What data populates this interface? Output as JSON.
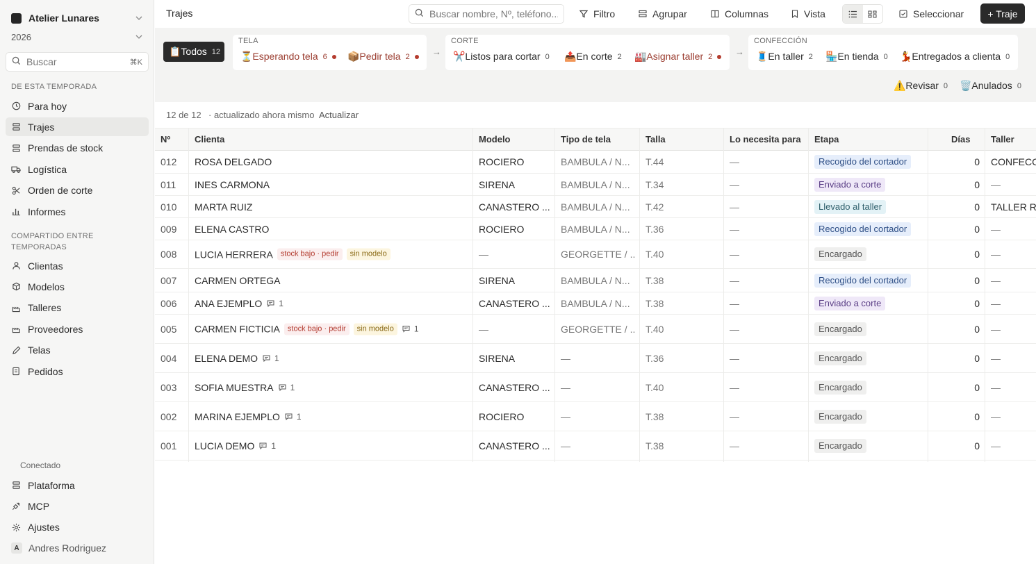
{
  "workspace": {
    "name": "Atelier Lunares",
    "year": "2026"
  },
  "sidebar": {
    "search_placeholder": "Buscar",
    "search_shortcut": "⌘K",
    "section1": "DE ESTA TEMPORADA",
    "items1": [
      {
        "label": "Para hoy",
        "icon": "clock-icon"
      },
      {
        "label": "Trajes",
        "icon": "layers-icon",
        "active": true
      },
      {
        "label": "Prendas de stock",
        "icon": "layers-icon"
      },
      {
        "label": "Logística",
        "icon": "truck-icon"
      },
      {
        "label": "Orden de corte",
        "icon": "scissors-icon"
      },
      {
        "label": "Informes",
        "icon": "chart-icon"
      }
    ],
    "section2_line1": "COMPARTIDO ENTRE",
    "section2_line2": "TEMPORADAS",
    "items2": [
      {
        "label": "Clientas",
        "icon": "user-icon"
      },
      {
        "label": "Modelos",
        "icon": "box-icon"
      },
      {
        "label": "Talleres",
        "icon": "factory-icon"
      },
      {
        "label": "Proveedores",
        "icon": "factory-icon"
      },
      {
        "label": "Telas",
        "icon": "pen-icon"
      },
      {
        "label": "Pedidos",
        "icon": "receipt-icon"
      }
    ],
    "connected_label": "Conectado",
    "items3": [
      {
        "label": "Plataforma",
        "icon": "layers-icon"
      },
      {
        "label": "MCP",
        "icon": "plug-icon"
      },
      {
        "label": "Ajustes",
        "icon": "gear-icon"
      }
    ],
    "user": {
      "initial": "A",
      "name": "Andres Rodriguez"
    }
  },
  "topbar": {
    "title": "Trajes",
    "search_placeholder": "Buscar nombre, Nº, teléfono...",
    "filter": "Filtro",
    "group": "Agrupar",
    "columns": "Columnas",
    "view": "Vista",
    "select": "Seleccionar",
    "new": "+ Traje"
  },
  "pipeline": {
    "all": {
      "label": "📋Todos",
      "count": "12"
    },
    "groups": [
      {
        "label": "TELA"
      },
      {
        "label": "CORTE"
      },
      {
        "label": "CONFECCIÓN"
      }
    ],
    "tela": [
      {
        "label": "⏳Esperando tela",
        "count": "6",
        "warn": true
      },
      {
        "label": "📦Pedir tela",
        "count": "2",
        "warn": true
      }
    ],
    "corte": [
      {
        "label": "✂️Listos para cortar",
        "count": "0"
      },
      {
        "label": "📤En corte",
        "count": "2"
      },
      {
        "label": "🏭Asignar taller",
        "count": "2",
        "warn": true
      }
    ],
    "confeccion": [
      {
        "label": "🧵En taller",
        "count": "2"
      },
      {
        "label": "🏪En tienda",
        "count": "0"
      },
      {
        "label": "💃Entregados a clienta",
        "count": "0"
      }
    ],
    "extra": [
      {
        "label": "⚠️Revisar",
        "count": "0"
      },
      {
        "label": "🗑️Anulados",
        "count": "0"
      }
    ]
  },
  "status": {
    "count": "12 de 12",
    "updated": "· actualizado ahora mismo",
    "refresh": "Actualizar"
  },
  "table": {
    "headers": {
      "num": "Nº",
      "client": "Clienta",
      "model": "Modelo",
      "fabric": "Tipo de tela",
      "size": "Talla",
      "need": "Lo necesita para",
      "stage": "Etapa",
      "days": "Días",
      "workshop": "Taller"
    },
    "rows": [
      {
        "num": "012",
        "client": "ROSA DELGADO",
        "model": "ROCIERO",
        "fabric": "BAMBULA / N...",
        "size": "T.44",
        "need": "—",
        "stage": "Recogido del cortador",
        "stage_color": "blue",
        "days": "0",
        "workshop": "CONFECCIONES"
      },
      {
        "num": "011",
        "client": "INES CARMONA",
        "model": "SIRENA",
        "fabric": "BAMBULA / N...",
        "size": "T.34",
        "need": "—",
        "stage": "Enviado a corte",
        "stage_color": "purple",
        "days": "0",
        "workshop": "—"
      },
      {
        "num": "010",
        "client": "MARTA RUIZ",
        "model": "CANASTERO ...",
        "fabric": "BAMBULA / N...",
        "size": "T.42",
        "need": "—",
        "stage": "Llevado al taller",
        "stage_color": "teal",
        "days": "0",
        "workshop": "TALLER ROSARIO"
      },
      {
        "num": "009",
        "client": "ELENA CASTRO",
        "model": "ROCIERO",
        "fabric": "BAMBULA / N...",
        "size": "T.36",
        "need": "—",
        "stage": "Recogido del cortador",
        "stage_color": "blue",
        "days": "0",
        "workshop": "—"
      },
      {
        "num": "008",
        "client": "LUCIA HERRERA",
        "badges": [
          "stock bajo · pedir",
          "sin modelo"
        ],
        "model": "—",
        "fabric": "GEORGETTE / ...",
        "size": "T.40",
        "need": "—",
        "stage": "Encargado",
        "stage_color": "gray",
        "days": "0",
        "workshop": "—"
      },
      {
        "num": "007",
        "client": "CARMEN ORTEGA",
        "model": "SIRENA",
        "fabric": "BAMBULA / N...",
        "size": "T.38",
        "need": "—",
        "stage": "Recogido del cortador",
        "stage_color": "blue",
        "days": "0",
        "workshop": "—"
      },
      {
        "num": "006",
        "client": "ANA EJEMPLO",
        "comments": "1",
        "model": "CANASTERO ...",
        "fabric": "BAMBULA / N...",
        "size": "T.38",
        "need": "—",
        "stage": "Enviado a corte",
        "stage_color": "purple",
        "days": "0",
        "workshop": "—"
      },
      {
        "num": "005",
        "client": "CARMEN FICTICIA",
        "badges": [
          "stock bajo · pedir",
          "sin modelo"
        ],
        "comments": "1",
        "model": "—",
        "fabric": "GEORGETTE / ...",
        "size": "T.40",
        "need": "—",
        "stage": "Encargado",
        "stage_color": "gray",
        "days": "0",
        "workshop": "—"
      },
      {
        "num": "004",
        "client": "ELENA DEMO",
        "comments": "1",
        "model": "SIRENA",
        "fabric": "—",
        "size": "T.36",
        "need": "—",
        "stage": "Encargado",
        "stage_color": "gray",
        "days": "0",
        "workshop": "—"
      },
      {
        "num": "003",
        "client": "SOFIA MUESTRA",
        "comments": "1",
        "model": "CANASTERO ...",
        "fabric": "—",
        "size": "T.40",
        "need": "—",
        "stage": "Encargado",
        "stage_color": "gray",
        "days": "0",
        "workshop": "—"
      },
      {
        "num": "002",
        "client": "MARINA EJEMPLO",
        "comments": "1",
        "model": "ROCIERO",
        "fabric": "—",
        "size": "T.38",
        "need": "—",
        "stage": "Encargado",
        "stage_color": "gray",
        "days": "0",
        "workshop": "—"
      },
      {
        "num": "001",
        "client": "LUCIA DEMO",
        "comments": "1",
        "model": "CANASTERO ...",
        "fabric": "—",
        "size": "T.38",
        "need": "—",
        "stage": "Encargado",
        "stage_color": "gray",
        "days": "0",
        "workshop": "—"
      }
    ]
  }
}
